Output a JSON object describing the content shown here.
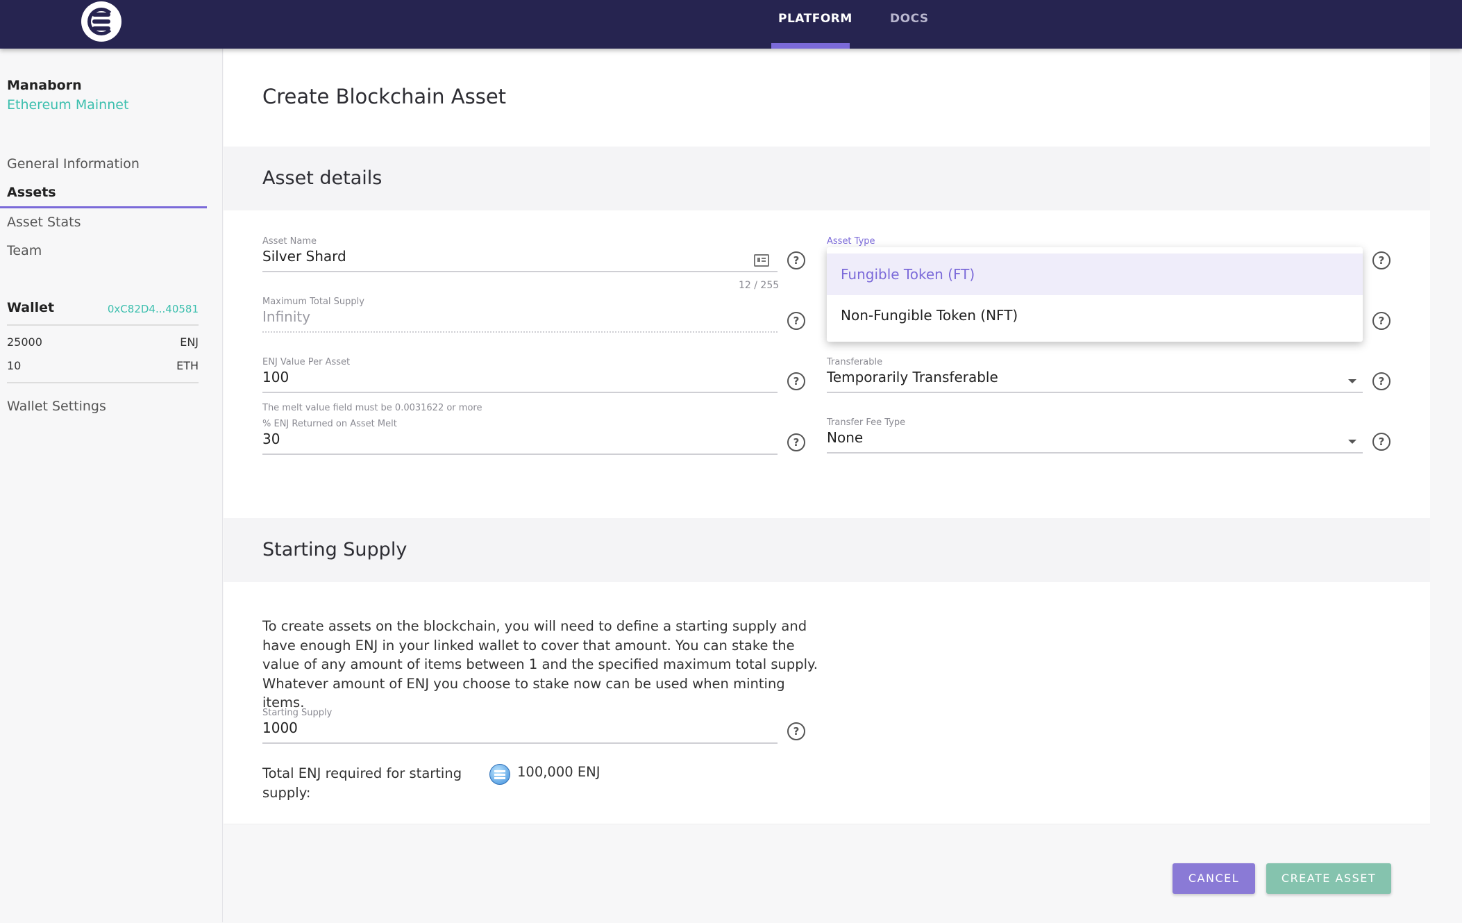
{
  "topnav": {
    "items": [
      {
        "label": "PLATFORM",
        "active": true
      },
      {
        "label": "DOCS",
        "active": false
      }
    ]
  },
  "sidebar": {
    "project_name": "Manaborn",
    "network": "Ethereum Mainnet",
    "links": [
      "General Information",
      "Assets",
      "Asset Stats",
      "Team"
    ],
    "active_link": "Assets",
    "wallet": {
      "label": "Wallet",
      "address": "0xC82D4...40581",
      "balances": [
        {
          "amount": "25000",
          "unit": "ENJ"
        },
        {
          "amount": "10",
          "unit": "ETH"
        }
      ]
    },
    "wallet_settings": "Wallet Settings"
  },
  "page": {
    "title": "Create Blockchain Asset"
  },
  "asset_details": {
    "title": "Asset details",
    "asset_name": {
      "label": "Asset Name",
      "value": "Silver Shard",
      "counter": "12 / 255"
    },
    "max_supply": {
      "label": "Maximum Total Supply",
      "value": "Infinity"
    },
    "enj_value": {
      "label": "ENJ Value Per Asset",
      "value": "100",
      "hint": "The melt value field must be 0.0031622 or more"
    },
    "melt_return": {
      "label": "% ENJ Returned on Asset Melt",
      "value": "30"
    },
    "asset_type": {
      "label": "Asset Type",
      "options": [
        "Fungible Token (FT)",
        "Non-Fungible Token (NFT)"
      ],
      "selected": "Fungible Token (FT)"
    },
    "transferable": {
      "label": "Transferable",
      "value": "Temporarily Transferable"
    },
    "transfer_fee": {
      "label": "Transfer Fee Type",
      "value": "None"
    }
  },
  "starting_supply": {
    "title": "Starting Supply",
    "description": "To create assets on the blockchain, you will need to define a starting supply and have enough ENJ in your linked wallet to cover that amount. You can stake the value of any amount of items between 1 and the specified maximum total supply. Whatever amount of ENJ you choose to stake now can be used when minting items.",
    "field": {
      "label": "Starting Supply",
      "value": "1000"
    },
    "total_label": "Total ENJ required for starting supply:",
    "total_value": "100,000 ENJ"
  },
  "actions": {
    "cancel": "CANCEL",
    "create": "CREATE ASSET"
  },
  "help_glyph": "?",
  "colors": {
    "nav_bg": "#262450",
    "accent": "#7b6ad9",
    "teal": "#3cbfae",
    "create_btn": "#85c3ae"
  },
  "icons": [
    "enjin-logo-icon",
    "help-icon",
    "id-card-icon",
    "dropdown-caret-icon",
    "enj-coin-icon"
  ]
}
